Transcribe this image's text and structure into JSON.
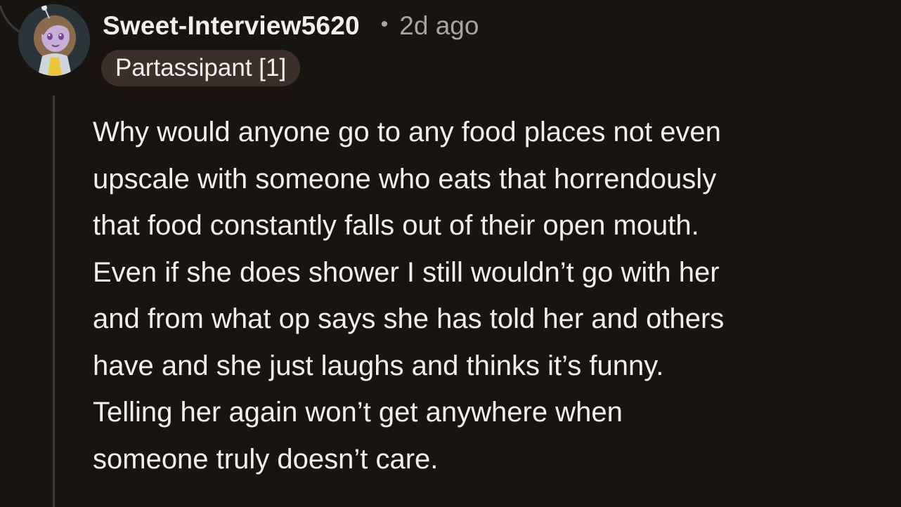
{
  "comment": {
    "username": "Sweet-Interview5620",
    "separator": "•",
    "timestamp": "2d ago",
    "flair": "Partassipant [1]",
    "body_lines": [
      "Why would anyone go to any food places not even",
      "upscale with someone who eats that horrendously",
      "that food constantly falls out of their open mouth.",
      "Even if she does shower I still wouldn’t go with her",
      "and from what op says she has told her and others",
      "have and she just laughs and thinks it’s funny.",
      "Telling her again won’t get anywhere when",
      "someone truly doesn’t care."
    ]
  },
  "icons": {
    "avatar": "user-avatar-icon"
  },
  "colors": {
    "background": "#181412",
    "text": "#f2f0ee",
    "muted": "#a8a4a0",
    "flair_bg": "#3a2f29",
    "thread_line": "#3d3835"
  }
}
